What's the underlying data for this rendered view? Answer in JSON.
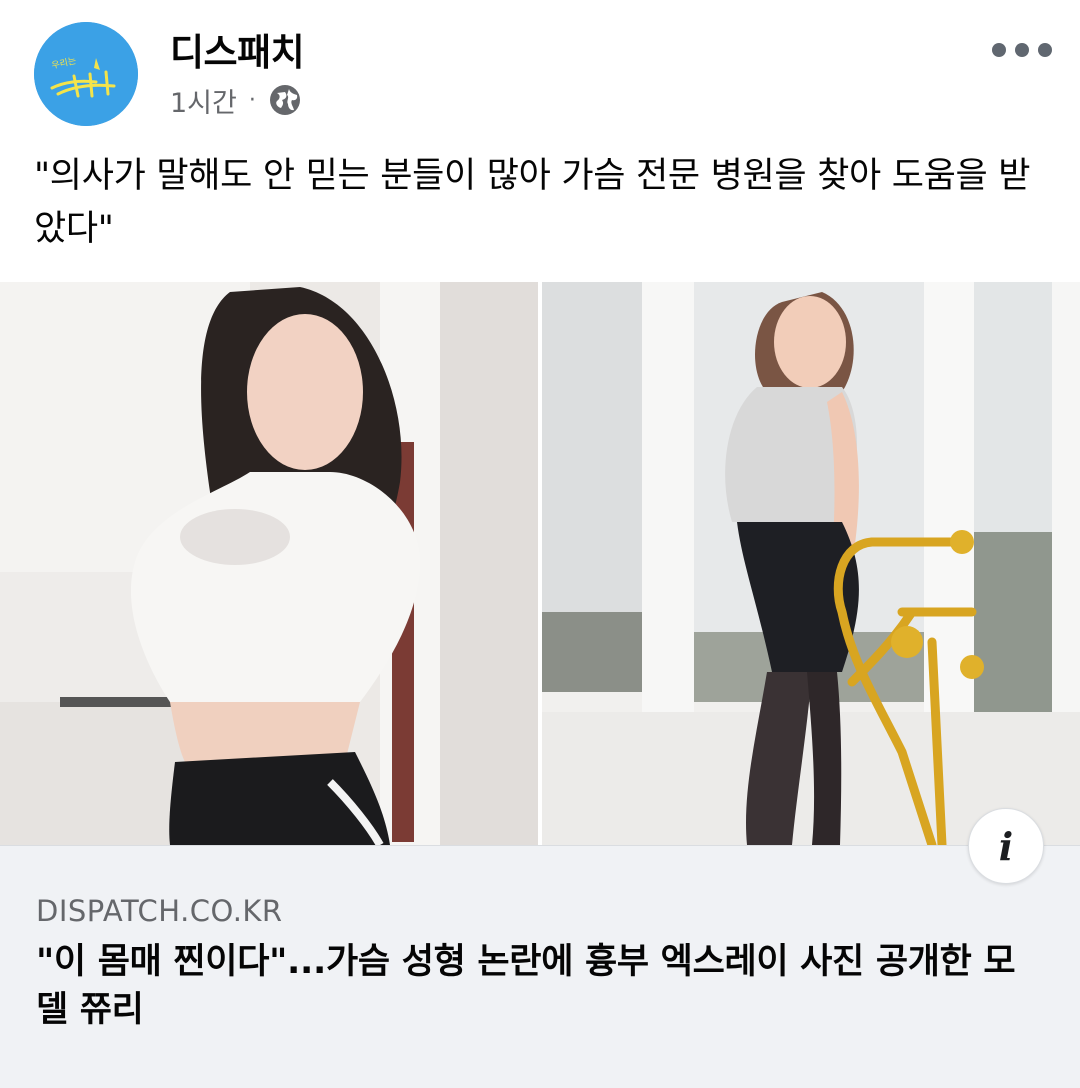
{
  "post": {
    "page_name": "디스패치",
    "avatar_text": "우리는 디스패치",
    "timestamp": "1시간",
    "separator": "·",
    "visibility_icon": "globe-icon",
    "menu_icon": "more-options-icon",
    "text": "\"의사가 말해도 안 믿는 분들이 많아 가슴 전문 병원을 찾아 도움을 받았다\""
  },
  "link_preview": {
    "domain": "DISPATCH.CO.KR",
    "title": "\"이 몸매 찐이다\"...가슴 성형 논란에 흉부 엑스레이 사진 공개한 모델 쮸리",
    "info_icon": "info-icon",
    "info_glyph": "i"
  },
  "colors": {
    "avatar_bg": "#3ba1e6",
    "secondary_text": "#65676b",
    "preview_bg": "#f0f2f5"
  }
}
